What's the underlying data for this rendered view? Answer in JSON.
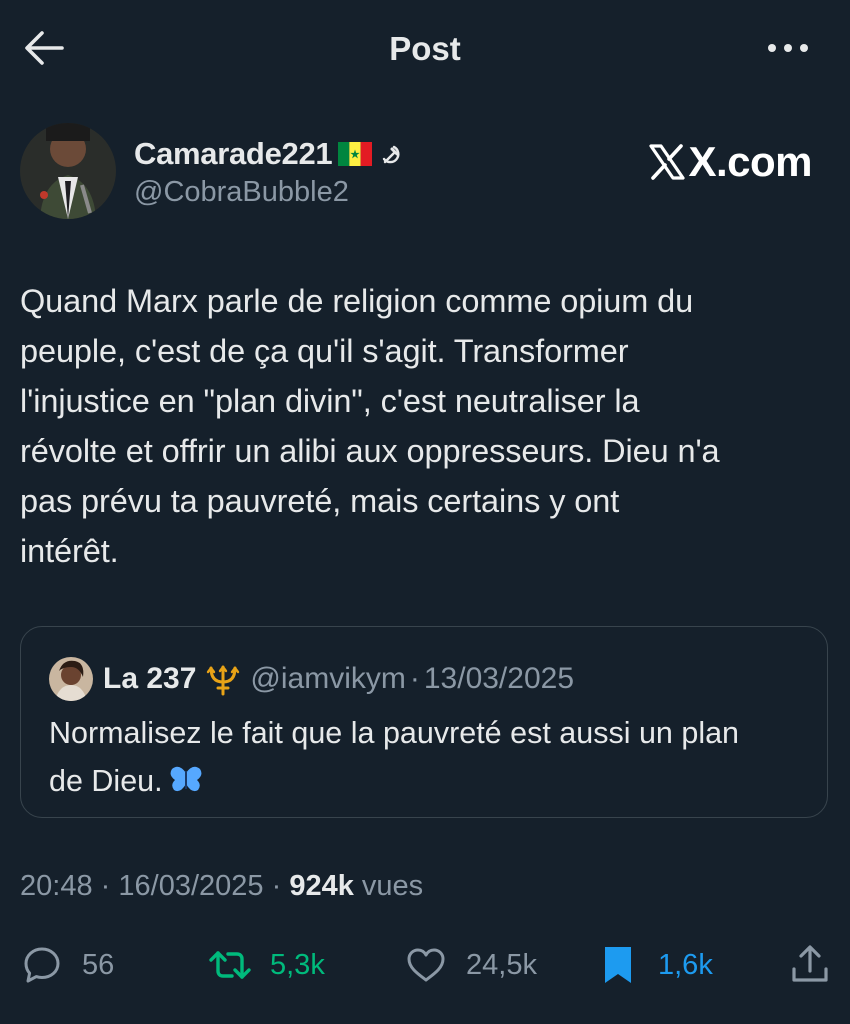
{
  "header": {
    "title": "Post"
  },
  "author": {
    "name": "Camarade221",
    "handle": "@CobraBubble2",
    "badge": "X.com"
  },
  "tweet": {
    "text": "Quand Marx parle de religion comme opium du\npeuple, c'est de ça qu'il s'agit. Transformer\nl'injustice en \"plan divin\", c'est neutraliser la\nrévolte et offrir un alibi aux oppresseurs. Dieu n'a\npas prévu ta pauvreté, mais certains y ont\nintérêt."
  },
  "quote": {
    "name": "La 237",
    "handle": "@iamvikym",
    "separator": "·",
    "date": "13/03/2025",
    "text": "Normalisez le fait que la pauvreté est aussi un plan\nde Dieu."
  },
  "meta": {
    "time": "20:48",
    "date": "16/03/2025",
    "separator": "·",
    "views": "924k",
    "views_label": "vues"
  },
  "actions": {
    "replies": "56",
    "reposts": "5,3k",
    "likes": "24,5k",
    "bookmarks": "1,6k"
  },
  "icons": {
    "back": "arrow-left-icon",
    "more": "more-horizontal-icon",
    "reply": "reply-icon",
    "repost": "repost-icon",
    "like": "heart-icon",
    "bookmark": "bookmark-icon",
    "share": "share-icon"
  },
  "colors": {
    "background": "#15202b",
    "text": "#e7e9ea",
    "muted": "#8b98a5",
    "repost_active": "#00ba7c",
    "bookmark_active": "#1d9bf0",
    "border": "#38444d"
  }
}
